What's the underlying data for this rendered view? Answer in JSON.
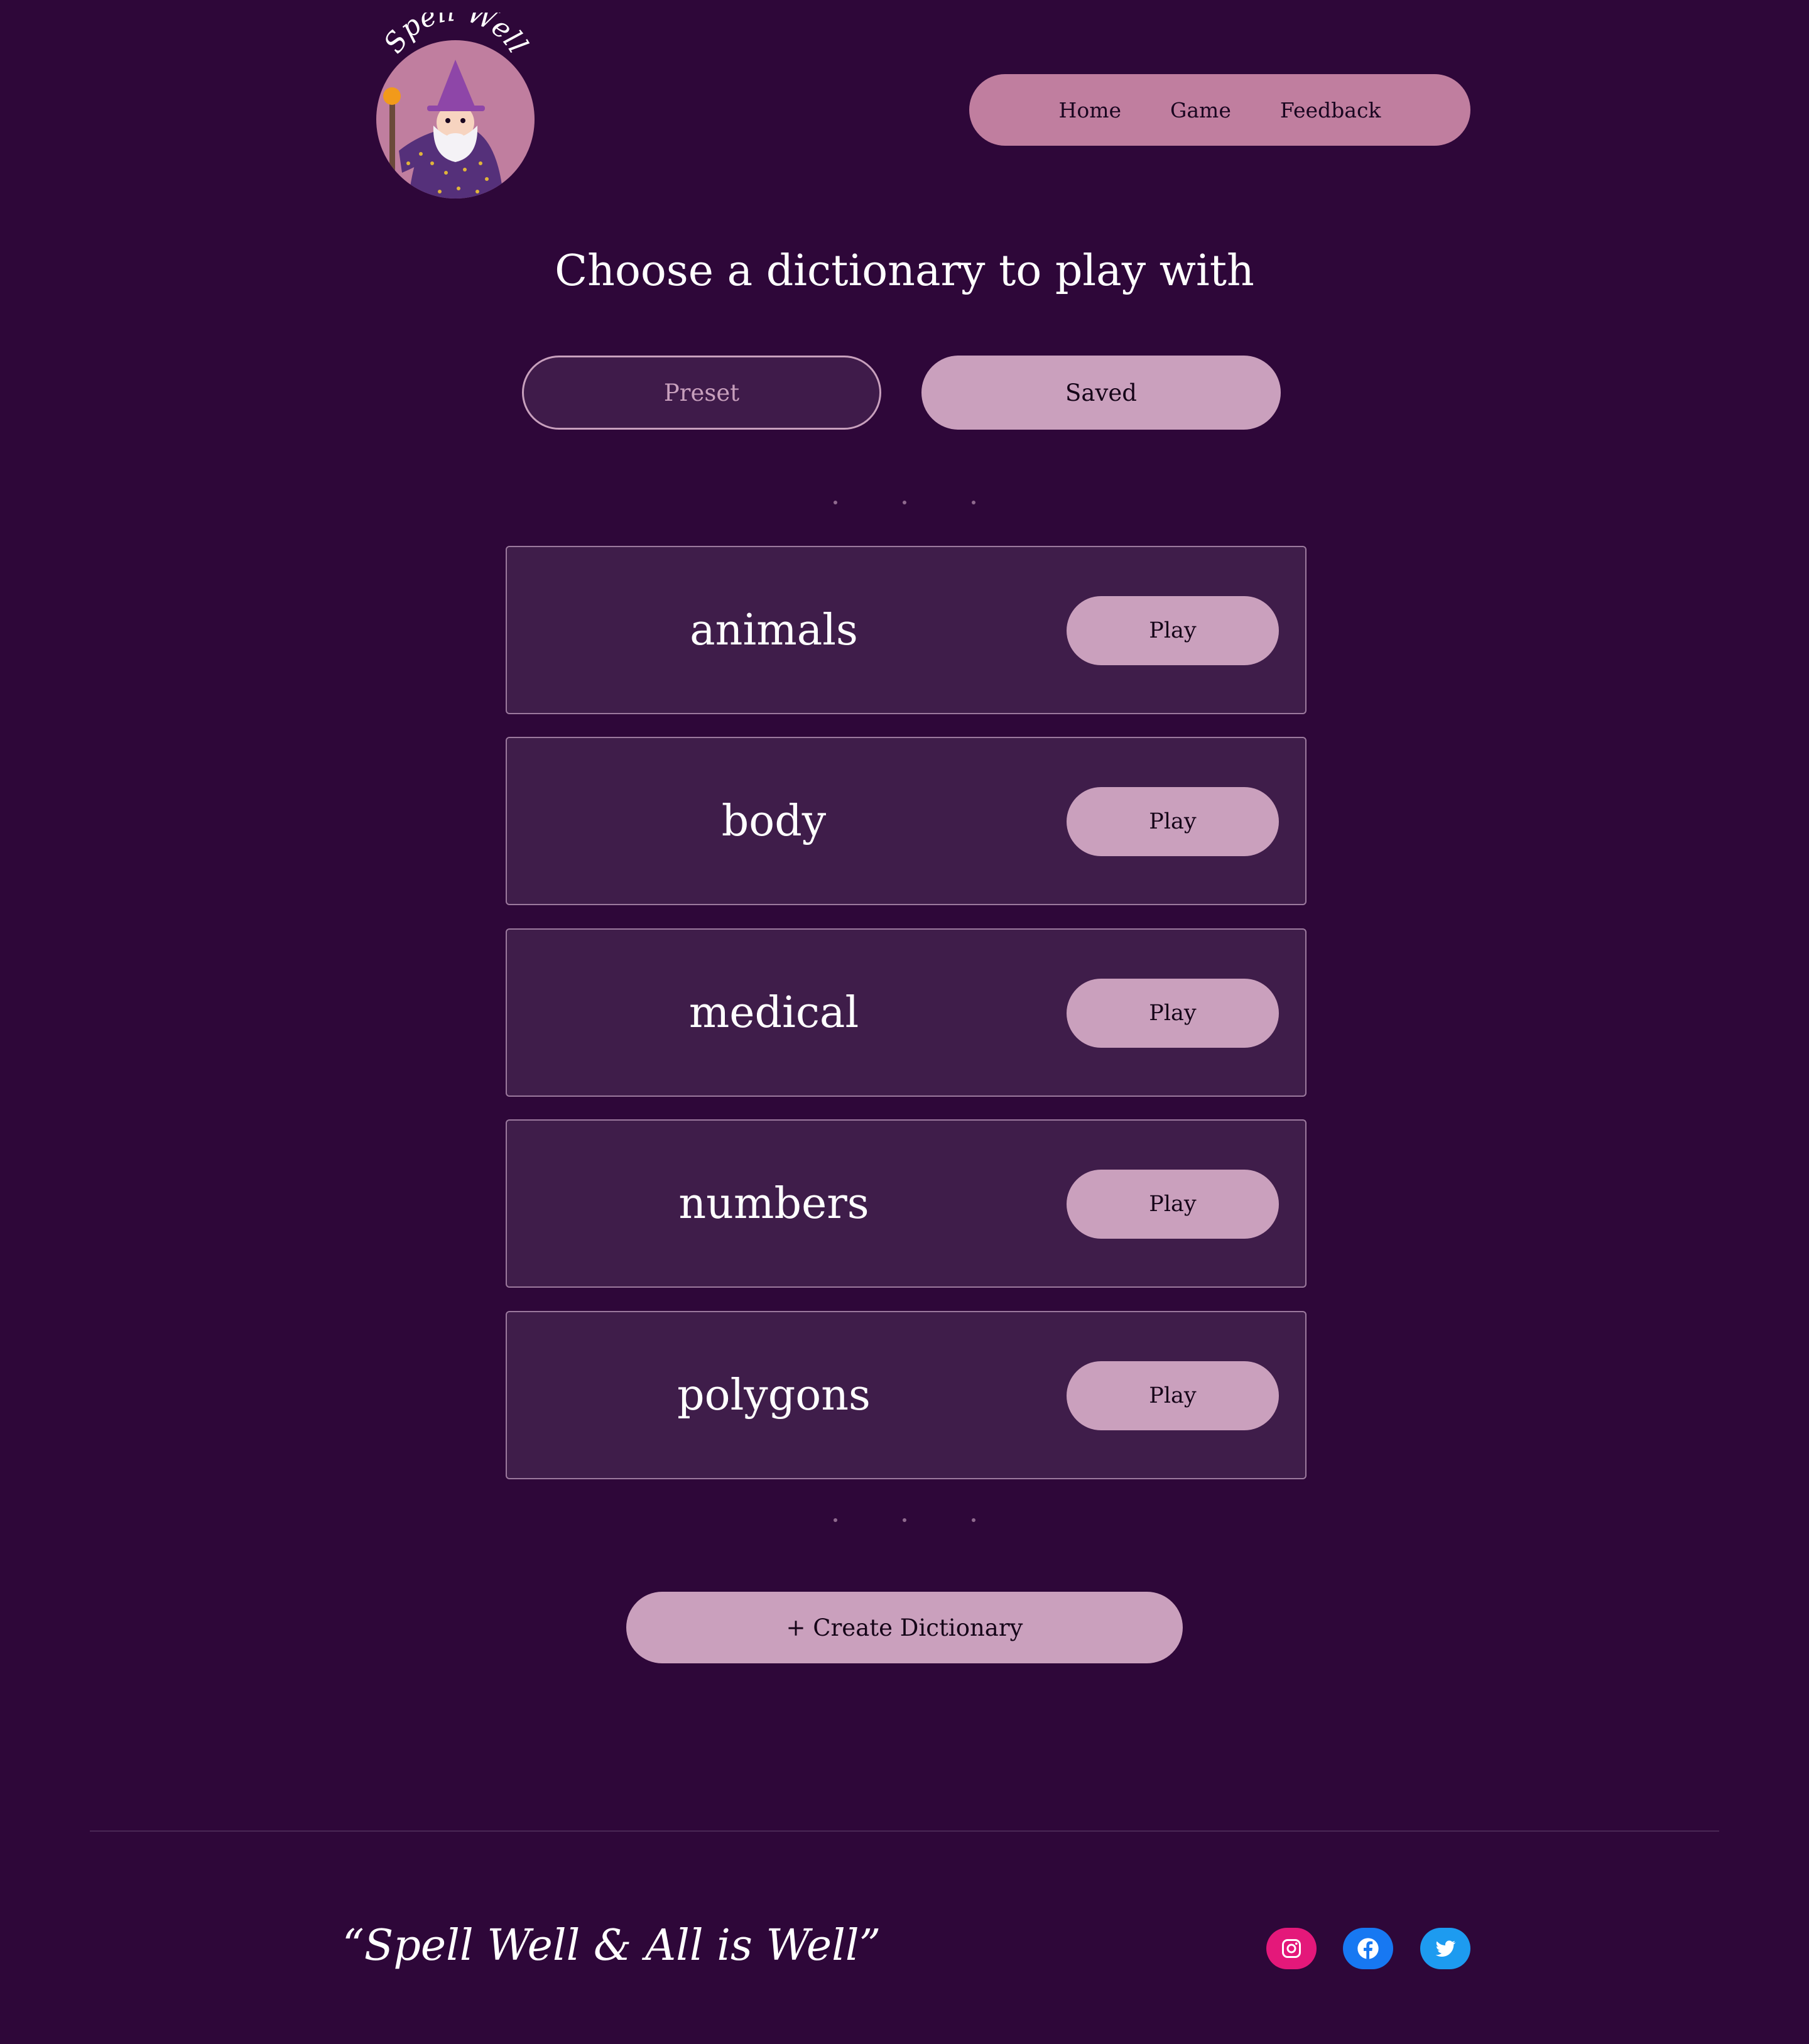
{
  "brand": {
    "logo_text": "Spell Well"
  },
  "nav": {
    "items": [
      {
        "label": "Home"
      },
      {
        "label": "Game"
      },
      {
        "label": "Feedback"
      }
    ]
  },
  "main": {
    "title": "Choose a dictionary to play with",
    "toggle": {
      "preset_label": "Preset",
      "saved_label": "Saved",
      "active": "Saved"
    },
    "dictionaries": [
      {
        "name": "animals",
        "play_label": "Play"
      },
      {
        "name": "body",
        "play_label": "Play"
      },
      {
        "name": "medical",
        "play_label": "Play"
      },
      {
        "name": "numbers",
        "play_label": "Play"
      },
      {
        "name": "polygons",
        "play_label": "Play"
      }
    ],
    "create_label": "+ Create Dictionary"
  },
  "footer": {
    "tagline": "“Spell Well & All is Well”",
    "social": [
      {
        "icon": "instagram-icon",
        "color": "#e4187a"
      },
      {
        "icon": "facebook-icon",
        "color": "#1778f2"
      },
      {
        "icon": "twitter-icon",
        "color": "#1d9bf0"
      }
    ]
  },
  "colors": {
    "background": "#2e0739",
    "accent": "#caa0bd",
    "nav": "#c07e9f",
    "card": "#3f1d4a"
  }
}
